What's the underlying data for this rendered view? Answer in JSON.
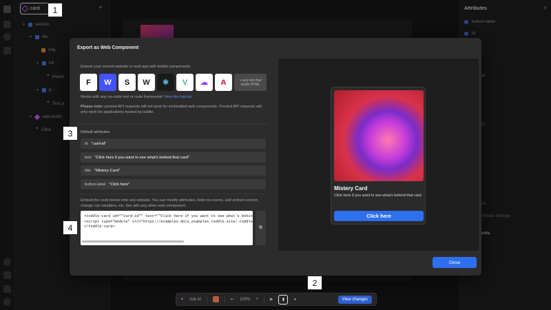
{
  "tree": {
    "search_value": "card",
    "items": [
      {
        "label": "section",
        "color": "#4a74e0"
      },
      {
        "label": "div",
        "color": "#4a74e0"
      },
      {
        "label": "img",
        "color": "#e08a30"
      },
      {
        "label": "h4",
        "color": "#4a74e0"
      },
      {
        "label": "Headi",
        "color": ""
      },
      {
        "label": "p",
        "color": "#4a74e0"
      },
      {
        "label": "Text p",
        "color": ""
      },
      {
        "label": "card-butto",
        "color": "#c264f0"
      },
      {
        "label": "Click",
        "color": ""
      }
    ]
  },
  "right_panel": {
    "title": "Attributes",
    "attr1": "button-label",
    "attr2": "id",
    "partials": [
      "ck",
      "ad",
      "ttribute change",
      "ents"
    ]
  },
  "badges": {
    "b1": "1",
    "b2": "2",
    "b3": "3",
    "b4": "4"
  },
  "modal": {
    "title": "Export as Web Component",
    "intro": "Extend your current website or web app with toddle components.",
    "works_with": "Works with any no-code tool or code framework!",
    "tutorial_link": "View the tutorial",
    "note_label": "Please note:",
    "note_text": "proxied API requests will not work for embedded web components. Proxied API requests will only work for applications hosted by toddle.",
    "any_tool": "+ any tool that reads HTML",
    "logos": [
      {
        "name": "framer-icon",
        "glyph": "F",
        "bg": "#ffffff",
        "fg": "#111111"
      },
      {
        "name": "webflow-icon",
        "glyph": "W",
        "bg": "#4353ff",
        "fg": "#ffffff"
      },
      {
        "name": "squarespace-icon",
        "glyph": "S",
        "bg": "#ffffff",
        "fg": "#111111"
      },
      {
        "name": "wordpress-icon",
        "glyph": "W",
        "bg": "#ffffff",
        "fg": "#222222"
      },
      {
        "name": "react-icon",
        "glyph": "⚛",
        "bg": "#1a1a1a",
        "fg": "#61dafb"
      },
      {
        "name": "vue-icon",
        "glyph": "V",
        "bg": "#ffffff",
        "fg": "#41b883"
      },
      {
        "name": "cloud-icon",
        "glyph": "☁",
        "bg": "#ffffff",
        "fg": "#9b3cf0"
      },
      {
        "name": "angular-icon",
        "glyph": "A",
        "bg": "#ffffff",
        "fg": "#dd0031"
      }
    ],
    "default_attributes_title": "Default attributes",
    "attributes": [
      {
        "key": "id",
        "value": "\"card-id\""
      },
      {
        "key": "text",
        "value": "\"Click here if you want to see what's behind that card\""
      },
      {
        "key": "title",
        "value": "\"Mistery Card\""
      },
      {
        "key": "button-label",
        "value": "\"Click here\""
      }
    ],
    "embed_text": "Embed the code below onto any website. You can modify attributes, listen to events, add slotted content, change css variables, etc. like with any other web-component.",
    "code_lines": [
      "<toddle-card id=\"\"card-id\"\" text=\"\"Click here if you want to see what's behind that ca",
      "  <script type=\"module\" src=\"https://examples-docs_examples.toddle.site/.toddle/cu",
      "</toddle-card>"
    ],
    "close_label": "Close"
  },
  "preview_card": {
    "title": "Mistery Card",
    "text": "Click here if you want to see what's behind that card",
    "button": "Click here"
  },
  "toolbar": {
    "ask_ai": "Ask AI",
    "zoom": "100%",
    "view_changes": "View changes"
  }
}
